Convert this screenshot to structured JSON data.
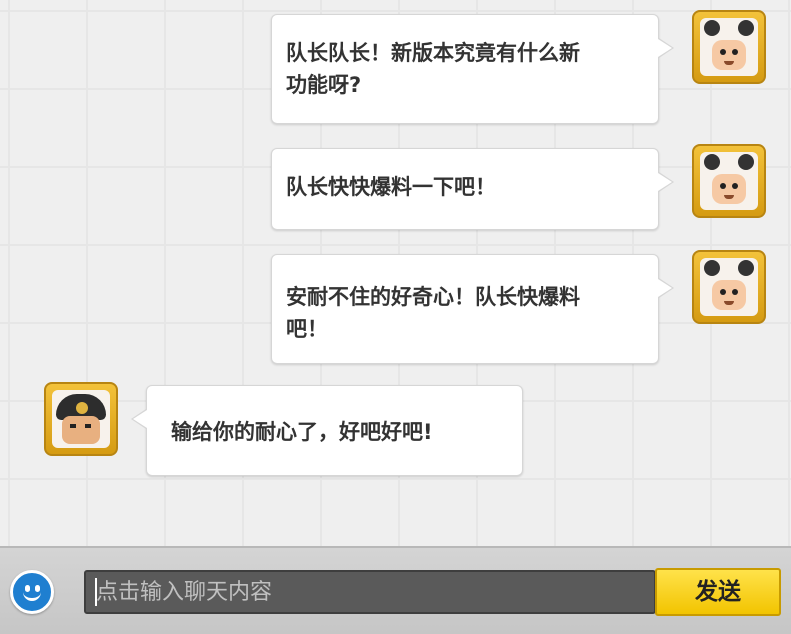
{
  "messages": [
    {
      "side": "right",
      "avatar": "panda-avatar",
      "lines": [
        "队长队长！新版本究竟有什么新",
        "功能呀?"
      ]
    },
    {
      "side": "right",
      "avatar": "panda-avatar",
      "lines": [
        "队长快快爆料一下吧！"
      ]
    },
    {
      "side": "right",
      "avatar": "panda-avatar",
      "lines": [
        "安耐不住的好奇心！队长快爆料",
        "吧！"
      ]
    },
    {
      "side": "left",
      "avatar": "soldier-avatar",
      "lines": [
        "输给你的耐心了，好吧好吧!"
      ]
    }
  ],
  "input": {
    "placeholder": "点击输入聊天内容",
    "value": ""
  },
  "send_label": "发送",
  "icons": {
    "emoji": "emoji-smile-icon"
  },
  "colors": {
    "accent": "#f2c400",
    "emoji_button": "#1f7fd0",
    "input_bg": "#5a5a5a"
  }
}
